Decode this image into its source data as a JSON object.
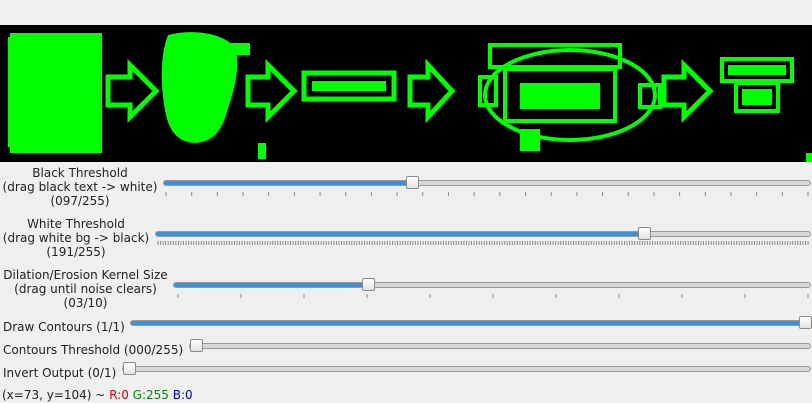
{
  "sliders": [
    {
      "label_lines": [
        "Black Threshold",
        "(drag black text -> white)",
        "(097/255)"
      ],
      "value": 97,
      "max": 255
    },
    {
      "label_lines": [
        "White Threshold",
        "(drag white bg -> black)",
        "(191/255)"
      ],
      "value": 191,
      "max": 255
    },
    {
      "label_lines": [
        "Dilation/Erosion Kernel Size",
        "(drag until noise clears)",
        "(03/10)"
      ],
      "value": 3,
      "max": 10
    },
    {
      "label": "Draw Contours (1/1)",
      "value": 1,
      "max": 1
    },
    {
      "label": "Contours Threshold (000/255)",
      "value": 0,
      "max": 255
    },
    {
      "label": "Invert Output (0/1)",
      "value": 0,
      "max": 1
    }
  ],
  "status": {
    "coords": "(x=73, y=104) ~",
    "r": "R:0",
    "g": "G:255",
    "b": "B:0"
  },
  "colors": {
    "image_bg": "#000000",
    "contour_green": "#00ff00",
    "slider_fill": "#3d8fd6",
    "r_text": "#e00000",
    "g_text": "#008800",
    "b_text": "#0000dd"
  }
}
